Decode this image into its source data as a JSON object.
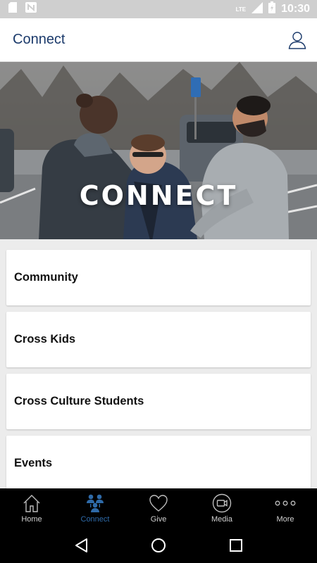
{
  "status_bar": {
    "time": "10:30",
    "network": "LTE",
    "icons": [
      "sd-card-icon",
      "n-notification-icon",
      "signal-icon",
      "battery-icon"
    ]
  },
  "header": {
    "title": "Connect",
    "profile_icon": "person-outline-icon"
  },
  "hero": {
    "title": "CONNECT"
  },
  "list": {
    "items": [
      {
        "label": "Community"
      },
      {
        "label": "Cross Kids"
      },
      {
        "label": "Cross Culture Students"
      },
      {
        "label": "Events"
      }
    ]
  },
  "tabs": [
    {
      "label": "Home",
      "icon": "home-icon",
      "active": false
    },
    {
      "label": "Connect",
      "icon": "people-icon",
      "active": true
    },
    {
      "label": "Give",
      "icon": "heart-icon",
      "active": false
    },
    {
      "label": "Media",
      "icon": "video-icon",
      "active": false
    },
    {
      "label": "More",
      "icon": "more-dots-icon",
      "active": false
    }
  ],
  "system_nav": {
    "icons": [
      "back-icon",
      "home-circle-icon",
      "recents-icon"
    ]
  },
  "colors": {
    "accent": "#2e6aa8",
    "title": "#1b3a6b",
    "tab_bar": "#000000",
    "status_bar": "#cfcfcf"
  }
}
